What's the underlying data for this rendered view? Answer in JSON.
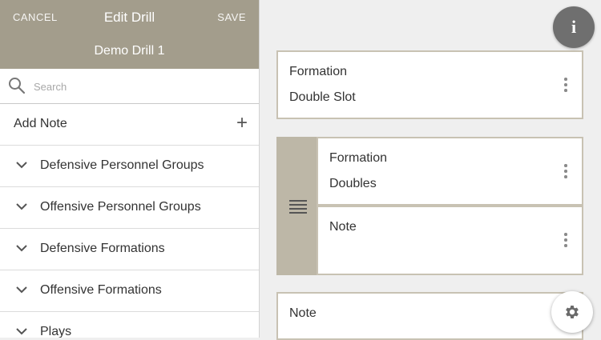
{
  "header": {
    "cancel_label": "CANCEL",
    "title": "Edit Drill",
    "save_label": "SAVE",
    "drill_name": "Demo Drill 1"
  },
  "search": {
    "placeholder": "Search",
    "icon": "search-icon"
  },
  "add_note": {
    "label": "Add Note",
    "icon": "+"
  },
  "categories": [
    {
      "label": "Defensive Personnel Groups"
    },
    {
      "label": "Offensive Personnel Groups"
    },
    {
      "label": "Defensive Formations"
    },
    {
      "label": "Offensive Formations"
    },
    {
      "label": "Plays"
    }
  ],
  "cards": [
    {
      "type": "Formation",
      "value": "Double Slot"
    },
    {
      "type": "Formation",
      "value": "Doubles"
    },
    {
      "type": "Note",
      "value": ""
    },
    {
      "type": "Note",
      "value": ""
    }
  ],
  "buttons": {
    "info": "i",
    "info_icon": "info-icon",
    "settings_icon": "gear-icon"
  },
  "colors": {
    "header": "#a39d8c",
    "group": "#bdb7a7",
    "card_border": "#c8c2b3"
  }
}
